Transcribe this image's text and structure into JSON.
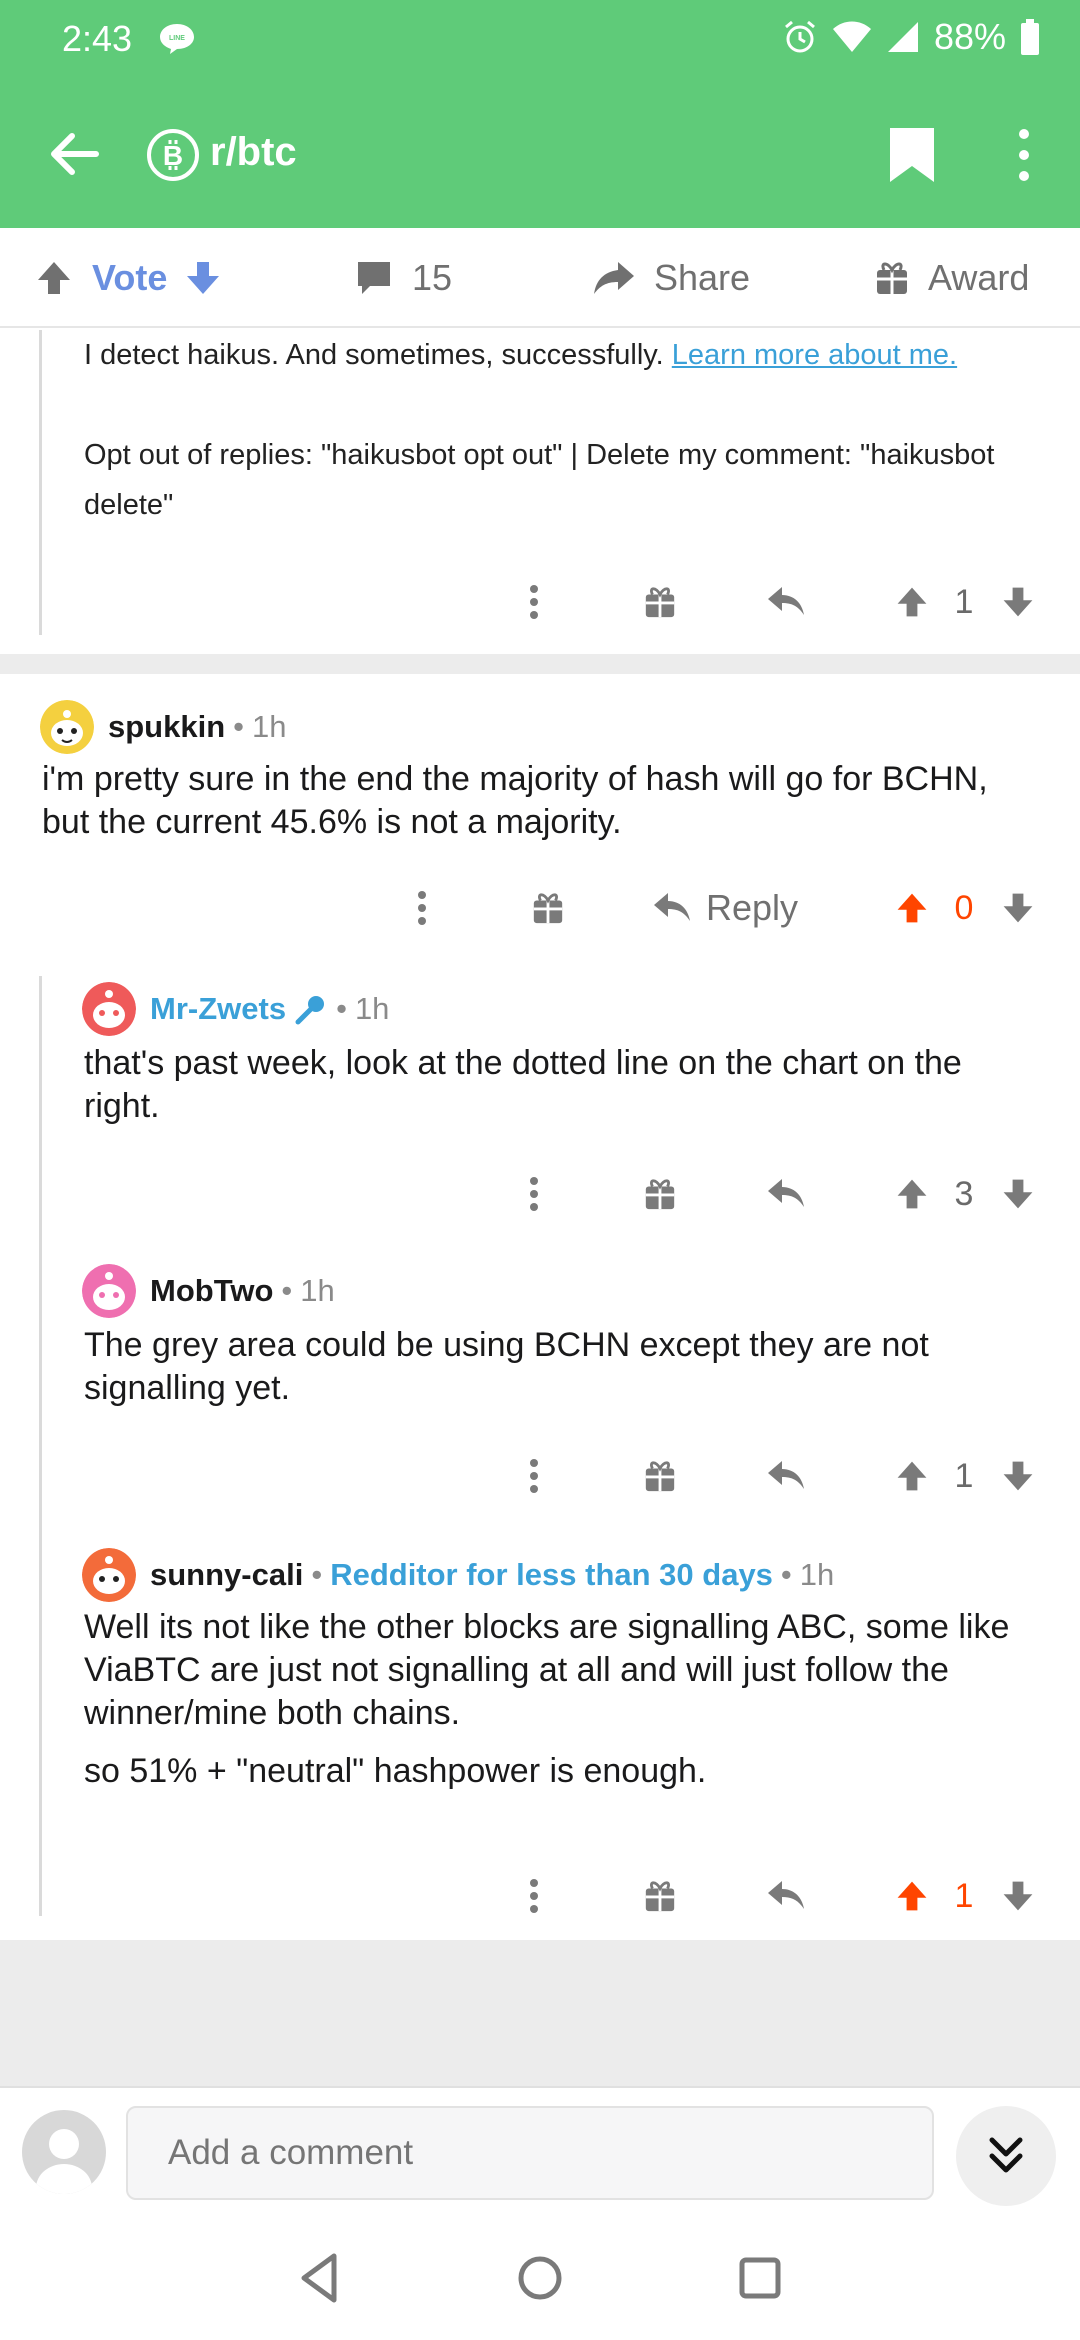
{
  "status_bar": {
    "time": "2:43",
    "battery": "88%"
  },
  "app_bar": {
    "title": "r/btc"
  },
  "post_bar": {
    "vote_label": "Vote",
    "comment_count": "15",
    "share_label": "Share",
    "award_label": "Award"
  },
  "bot_comment": {
    "line1": "I detect haikus. And sometimes, successfully.",
    "link": "Learn more about me.",
    "optout": "Opt out of replies: \"haikusbot opt out\" | Delete my comment: \"haikusbot delete\"",
    "score": "1"
  },
  "comments": [
    {
      "author": "spukkin",
      "age": "1h",
      "body": "i'm pretty sure in the end the majority of hash will go for BCHN, but the current 45.6% is not a majority.",
      "reply_label": "Reply",
      "score": "0",
      "upvoted": true
    },
    {
      "author": "Mr-Zwets",
      "age": "1h",
      "body": "that's past week, look at the dotted line on the chart on the right.",
      "score": "3"
    },
    {
      "author": "MobTwo",
      "age": "1h",
      "body": "The grey area could be using BCHN except they are not signalling yet.",
      "score": "1"
    },
    {
      "author": "sunny-cali",
      "flair": "Redditor for less than 30 days",
      "age": "1h",
      "body1": "Well its not like the other blocks are signalling ABC, some like ViaBTC are just not signalling at all and will just follow the winner/mine both chains.",
      "body2": "so 51% + \"neutral\" hashpower is enough.",
      "score": "1",
      "upvoted": true
    }
  ],
  "composer": {
    "placeholder": "Add a comment"
  },
  "colors": {
    "brand_green": "#5fcb79",
    "upvote": "#ff4500",
    "link": "#3aa0d8",
    "vote_blue": "#6a8fe0"
  }
}
